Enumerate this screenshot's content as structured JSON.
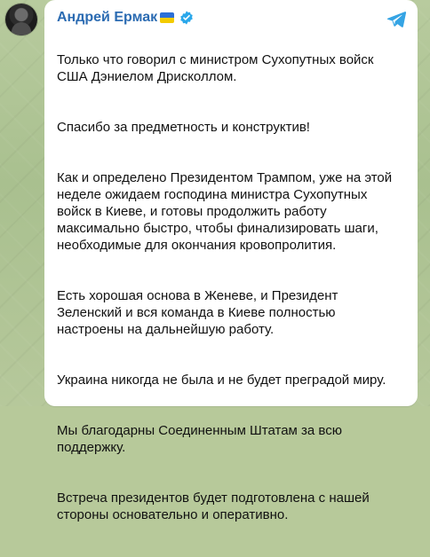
{
  "post": {
    "author": "Андрей Ермак",
    "paragraphs": [
      "Только что говорил с министром Сухопутных войск\nСША Дэниелом Дрисколлом.",
      "Спасибо за предметность и конструктив!",
      "Как и определено Президентом Трампом, уже на этой\nнеделе ожидаем господина министра Сухопутных\nвойск в Киеве, и готовы продолжить работу\nмаксимально быстро, чтобы финализировать шаги,\nнеобходимые для окончания кровопролития.",
      "Есть хорошая основа в Женеве, и Президент\nЗеленский и вся команда в Киеве полностью\nнастроены на дальнейшую работу.",
      "Украина никогда не была и не будет преградой миру.",
      "Мы благодарны Соединенным Штатам за всю\nподдержку.",
      "Встреча президентов будет подготовлена с нашей\nстороны основательно и оперативно."
    ]
  },
  "icons": {
    "avatar": "avatar",
    "flag": "ukraine-flag-icon",
    "verified": "verified-icon",
    "send": "telegram-send-icon"
  },
  "colors": {
    "author": "#2b6bb2",
    "text": "#111111",
    "bubble": "#ffffff",
    "background": "#b7c99a",
    "verified": "#2aa7ea",
    "send": "#35a4e4"
  }
}
